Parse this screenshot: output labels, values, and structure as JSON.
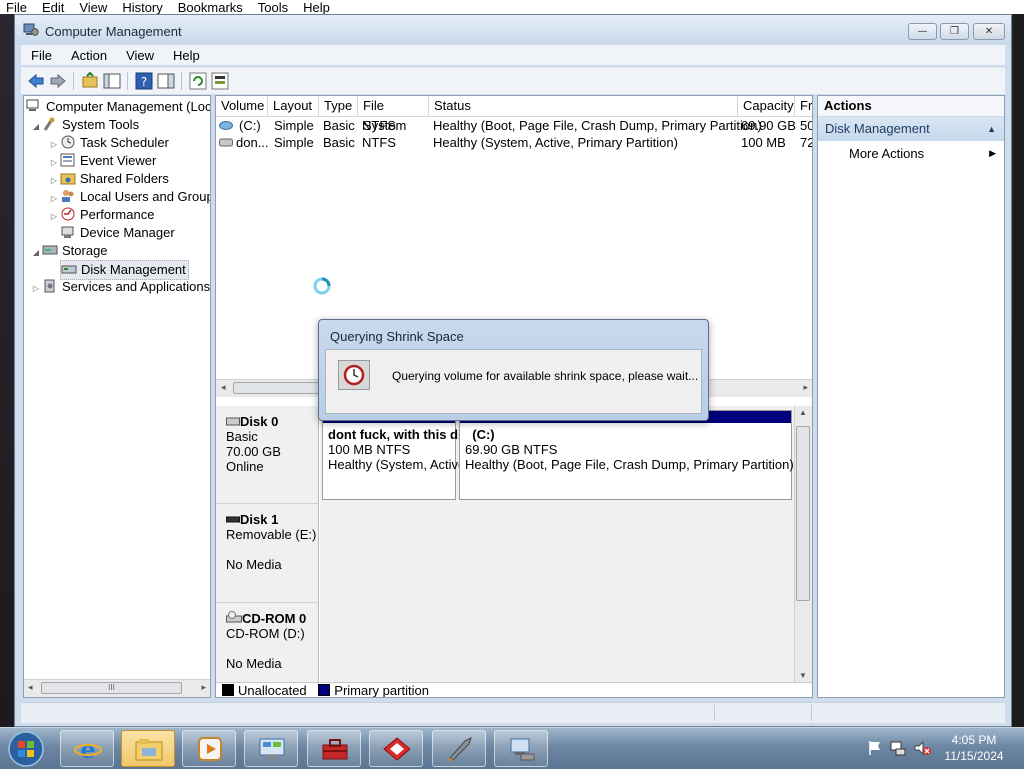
{
  "outer_menu": [
    "File",
    "Edit",
    "View",
    "History",
    "Bookmarks",
    "Tools",
    "Help"
  ],
  "window": {
    "title": "Computer Management",
    "controls": {
      "minimize": "—",
      "maximize": "❐",
      "close": "✕"
    }
  },
  "menu": [
    "File",
    "Action",
    "View",
    "Help"
  ],
  "tree": {
    "root": "Computer Management (Local",
    "system_tools": "System Tools",
    "task_scheduler": "Task Scheduler",
    "event_viewer": "Event Viewer",
    "shared_folders": "Shared Folders",
    "local_users": "Local Users and Groups",
    "performance": "Performance",
    "device_manager": "Device Manager",
    "storage": "Storage",
    "disk_management": "Disk Management",
    "services": "Services and Applications",
    "scroll_grip": "III"
  },
  "volume_table": {
    "columns": [
      "Volume",
      "Layout",
      "Type",
      "File System",
      "Status",
      "Capacity",
      "Fr"
    ],
    "rows": [
      {
        "volume": "(C:)",
        "layout": "Simple",
        "type": "Basic",
        "fs": "NTFS",
        "status": "Healthy (Boot, Page File, Crash Dump, Primary Partition)",
        "capacity": "69.90 GB",
        "free": "50"
      },
      {
        "volume": "don...",
        "layout": "Simple",
        "type": "Basic",
        "fs": "NTFS",
        "status": "Healthy (System, Active, Primary Partition)",
        "capacity": "100 MB",
        "free": "72"
      }
    ]
  },
  "disks": [
    {
      "name": "Disk 0",
      "line2": "Basic",
      "line3": "70.00 GB",
      "line4": "Online",
      "partitions": [
        {
          "name": "dont fuck, with this di",
          "size": "100 MB NTFS",
          "status": "Healthy (System, Active"
        },
        {
          "name": "(C:)",
          "size": "69.90 GB NTFS",
          "status": "Healthy (Boot, Page File, Crash Dump, Primary Partition)"
        }
      ]
    },
    {
      "name": "Disk 1",
      "line2": "Removable (E:)",
      "line3": "",
      "line4": "No Media"
    },
    {
      "name": "CD-ROM 0",
      "line2": "CD-ROM (D:)",
      "line3": "",
      "line4": "No Media"
    }
  ],
  "legend": [
    {
      "label": "Unallocated",
      "color": "#000000"
    },
    {
      "label": "Primary partition",
      "color": "#00007c"
    }
  ],
  "actions": {
    "title": "Actions",
    "section": "Disk Management",
    "more": "More Actions"
  },
  "dialog": {
    "title": "Querying Shrink Space",
    "message": "Querying volume for available shrink space, please wait..."
  },
  "taskbar": {
    "apps": [
      "internet-explorer",
      "windows-explorer",
      "media-player",
      "control-panel",
      "toolbox",
      "red-app",
      "rocket-app",
      "network-app"
    ],
    "time": "4:05 PM",
    "date": "11/15/2024"
  },
  "colors": {
    "primary_partition": "#00007c",
    "accent": "#c6d8ec"
  }
}
